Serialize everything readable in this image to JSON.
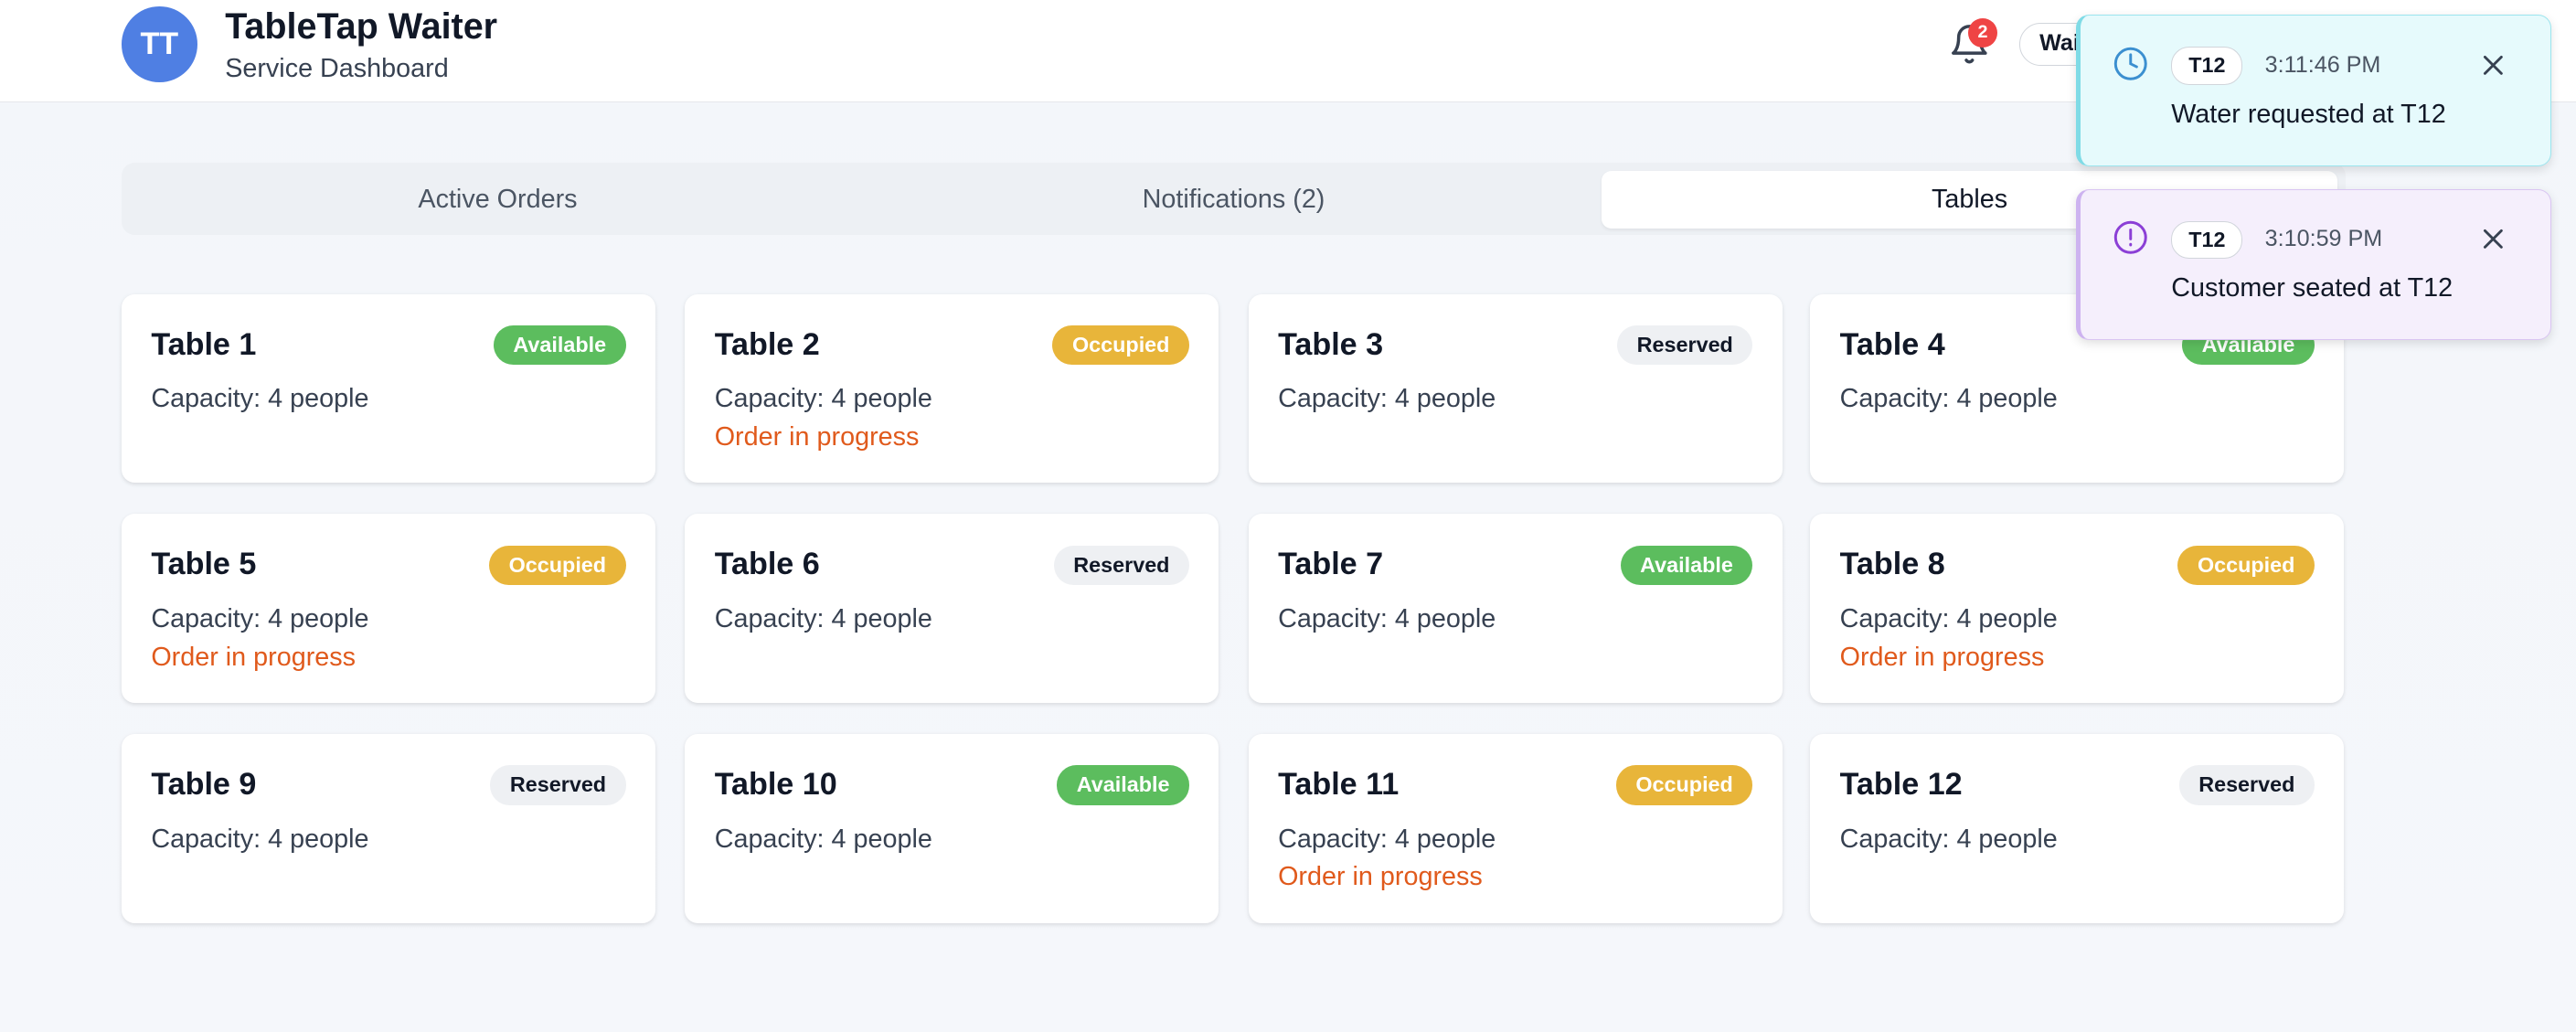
{
  "header": {
    "avatar_initials": "TT",
    "app_title": "TableTap Waiter",
    "app_subtitle": "Service Dashboard",
    "bell_icon": "bell-icon",
    "notification_count": "2",
    "role_label": "Waiter"
  },
  "tabs": [
    {
      "label": "Active Orders"
    },
    {
      "label": "Notifications (2)"
    },
    {
      "label": "Tables"
    }
  ],
  "tables": [
    {
      "name": "Table 1",
      "status": "Available",
      "capacity": "Capacity: 4 people",
      "progress": ""
    },
    {
      "name": "Table 2",
      "status": "Occupied",
      "capacity": "Capacity: 4 people",
      "progress": "Order in progress"
    },
    {
      "name": "Table 3",
      "status": "Reserved",
      "capacity": "Capacity: 4 people",
      "progress": ""
    },
    {
      "name": "Table 4",
      "status": "Available",
      "capacity": "Capacity: 4 people",
      "progress": ""
    },
    {
      "name": "Table 5",
      "status": "Occupied",
      "capacity": "Capacity: 4 people",
      "progress": "Order in progress"
    },
    {
      "name": "Table 6",
      "status": "Reserved",
      "capacity": "Capacity: 4 people",
      "progress": ""
    },
    {
      "name": "Table 7",
      "status": "Available",
      "capacity": "Capacity: 4 people",
      "progress": ""
    },
    {
      "name": "Table 8",
      "status": "Occupied",
      "capacity": "Capacity: 4 people",
      "progress": "Order in progress"
    },
    {
      "name": "Table 9",
      "status": "Reserved",
      "capacity": "Capacity: 4 people",
      "progress": ""
    },
    {
      "name": "Table 10",
      "status": "Available",
      "capacity": "Capacity: 4 people",
      "progress": ""
    },
    {
      "name": "Table 11",
      "status": "Occupied",
      "capacity": "Capacity: 4 people",
      "progress": "Order in progress"
    },
    {
      "name": "Table 12",
      "status": "Reserved",
      "capacity": "Capacity: 4 people",
      "progress": ""
    }
  ],
  "toasts": [
    {
      "icon": "clock-icon",
      "table": "T12",
      "time": "3:11:46 PM",
      "message": "Water requested at T12"
    },
    {
      "icon": "alert-circle-icon",
      "table": "T12",
      "time": "3:10:59 PM",
      "message": "Customer seated at T12"
    }
  ],
  "colors": {
    "available": "#5cbd5e",
    "occupied": "#e8b53a",
    "reserved": "#eef0f3",
    "progress_text": "#e05a1c",
    "avatar": "#4f7fe3",
    "badge_red": "#ef4444"
  }
}
